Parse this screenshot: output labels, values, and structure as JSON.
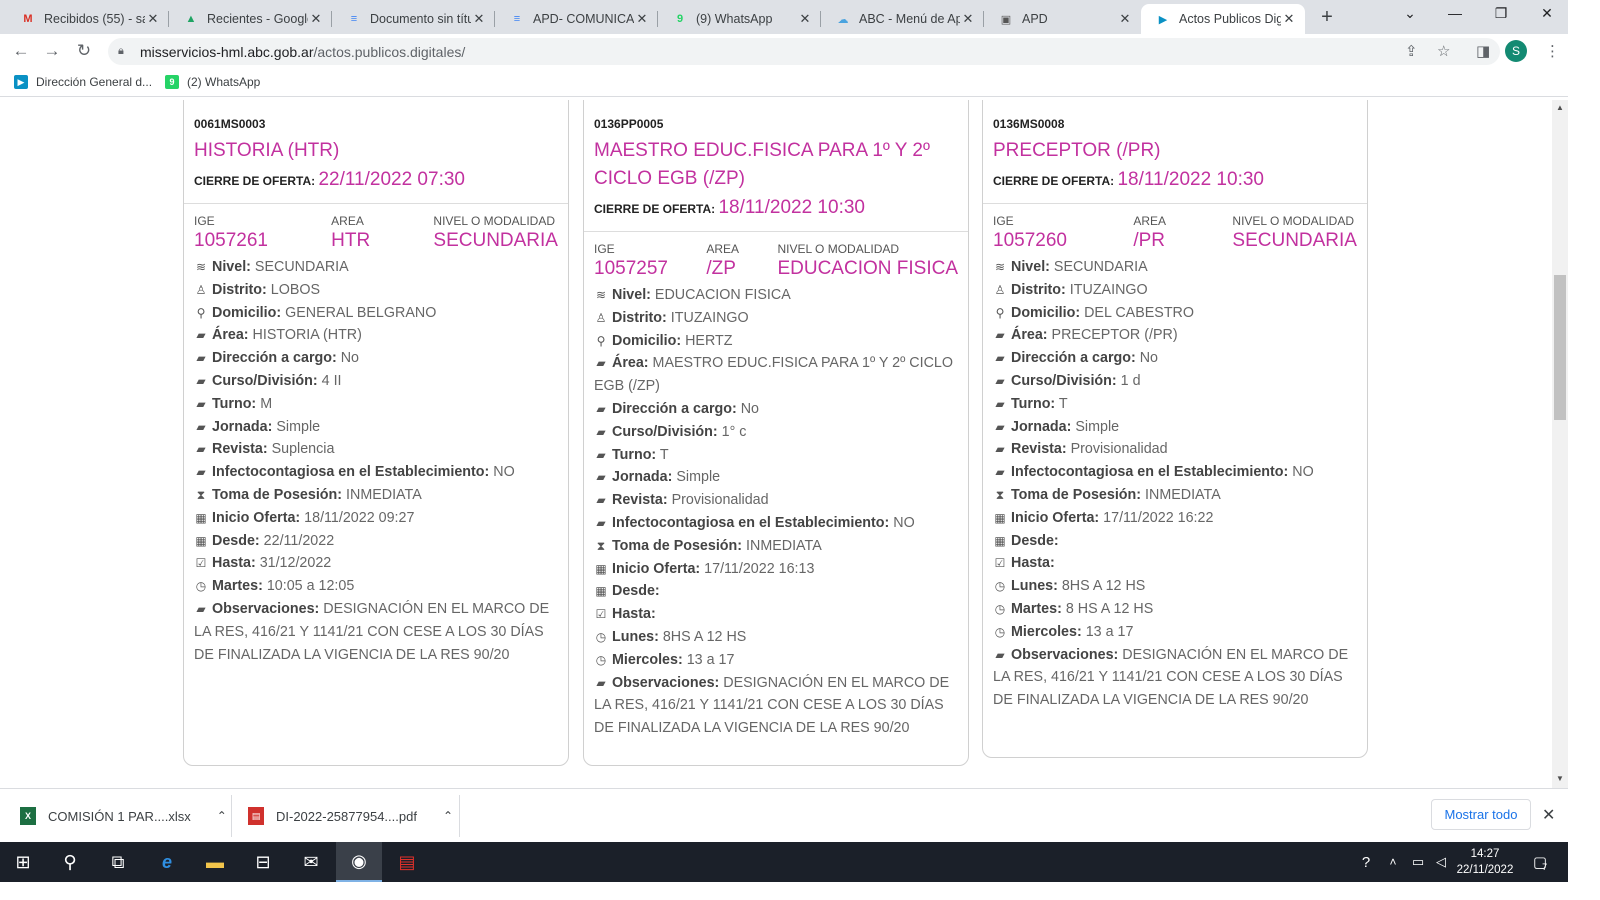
{
  "browser": {
    "tabs": [
      {
        "title": "Recibidos (55) - sar",
        "icon": "gmail-icon",
        "glyph": "M",
        "color": "#d93025"
      },
      {
        "title": "Recientes - Google",
        "icon": "google-drive-icon",
        "glyph": "▲",
        "color": "#1fa463"
      },
      {
        "title": "Documento sin títu",
        "icon": "google-docs-icon",
        "glyph": "≡",
        "color": "#4285f4"
      },
      {
        "title": "APD- COMUNICAD",
        "icon": "google-docs-icon",
        "glyph": "≡",
        "color": "#4285f4"
      },
      {
        "title": "(9) WhatsApp",
        "icon": "whatsapp-icon",
        "glyph": "9",
        "color": "#25d366"
      },
      {
        "title": "ABC - Menú de Ap",
        "icon": "cloud-icon",
        "glyph": "☁",
        "color": "#4aa3df"
      },
      {
        "title": "APD",
        "icon": "apd-icon",
        "glyph": "▣",
        "color": "#555"
      },
      {
        "title": "Actos Publicos Dig",
        "icon": "abc-flag-icon",
        "glyph": "▶",
        "color": "#0a91c4"
      }
    ],
    "new_tab": "+",
    "url_host": "misservicios-hml.abc.gob.ar",
    "url_path": "/actos.publicos.digitales/",
    "avatar_letter": "S",
    "bookmarks": [
      {
        "label": "Dirección General d...",
        "icon": "abc-flag-icon",
        "color": "#0a91c4",
        "glyph": "▶"
      },
      {
        "label": "(2) WhatsApp",
        "icon": "whatsapp-icon",
        "color": "#25d366",
        "glyph": "9"
      }
    ]
  },
  "cards": [
    {
      "code": "0061MS0003",
      "title": "HISTORIA (HTR)",
      "cierre_label": "CIERRE DE OFERTA:",
      "cierre_date": "22/11/2022 07:30",
      "ige_label": "IGE",
      "ige": "1057261",
      "area_label": "AREA",
      "area": "HTR",
      "nivel_label": "NIVEL O MODALIDAD",
      "nivel": "SECUNDARIA",
      "fields": [
        {
          "icon": "layers-icon",
          "glyph": "≋",
          "key": "Nivel:",
          "value": "SECUNDARIA"
        },
        {
          "icon": "street-view-icon",
          "glyph": "♙",
          "key": "Distrito:",
          "value": "LOBOS"
        },
        {
          "icon": "map-marker-icon",
          "glyph": "⚲",
          "key": "Domicilio:",
          "value": "GENERAL BELGRANO"
        },
        {
          "icon": "briefcase-icon",
          "glyph": "▰",
          "key": "Área:",
          "value": "HISTORIA (HTR)"
        },
        {
          "icon": "briefcase-icon",
          "glyph": "▰",
          "key": "Dirección a cargo:",
          "value": "No"
        },
        {
          "icon": "briefcase-icon",
          "glyph": "▰",
          "key": "Curso/División:",
          "value": "4 II"
        },
        {
          "icon": "briefcase-icon",
          "glyph": "▰",
          "key": "Turno:",
          "value": "M"
        },
        {
          "icon": "briefcase-icon",
          "glyph": "▰",
          "key": "Jornada:",
          "value": "Simple"
        },
        {
          "icon": "briefcase-icon",
          "glyph": "▰",
          "key": "Revista:",
          "value": "Suplencia"
        },
        {
          "icon": "briefcase-icon",
          "glyph": "▰",
          "key": "Infectocontagiosa en el Establecimiento:",
          "value": "NO"
        },
        {
          "icon": "hourglass-icon",
          "glyph": "⧗",
          "key": "Toma de Posesión:",
          "value": "INMEDIATA"
        },
        {
          "icon": "calendar-icon",
          "glyph": "▦",
          "key": "Inicio Oferta:",
          "value": "18/11/2022 09:27"
        },
        {
          "icon": "calendar-icon",
          "glyph": "▦",
          "key": "Desde:",
          "value": "22/11/2022"
        },
        {
          "icon": "calendar-check-icon",
          "glyph": "☑",
          "key": "Hasta:",
          "value": "31/12/2022"
        },
        {
          "icon": "clock-icon",
          "glyph": "◷",
          "key": "Martes:",
          "value": "10:05 a 12:05"
        },
        {
          "icon": "briefcase-icon",
          "glyph": "▰",
          "key": "Observaciones:",
          "value": "DESIGNACIÓN EN EL MARCO DE LA RES, 416/21 Y 1141/21 CON CESE A LOS 30 DÍAS DE FINALIZADA LA VIGENCIA DE LA RES 90/20"
        }
      ]
    },
    {
      "code": "0136PP0005",
      "title": "MAESTRO EDUC.FISICA PARA 1º Y 2º CICLO EGB (/ZP)",
      "cierre_label": "CIERRE DE OFERTA:",
      "cierre_date": "18/11/2022 10:30",
      "ige_label": "IGE",
      "ige": "1057257",
      "area_label": "AREA",
      "area": "/ZP",
      "nivel_label": "NIVEL O MODALIDAD",
      "nivel": "EDUCACION FISICA",
      "fields": [
        {
          "icon": "layers-icon",
          "glyph": "≋",
          "key": "Nivel:",
          "value": "EDUCACION FISICA"
        },
        {
          "icon": "street-view-icon",
          "glyph": "♙",
          "key": "Distrito:",
          "value": "ITUZAINGO"
        },
        {
          "icon": "map-marker-icon",
          "glyph": "⚲",
          "key": "Domicilio:",
          "value": "HERTZ"
        },
        {
          "icon": "briefcase-icon",
          "glyph": "▰",
          "key": "Área:",
          "value": "MAESTRO EDUC.FISICA PARA 1º Y 2º CICLO EGB (/ZP)"
        },
        {
          "icon": "briefcase-icon",
          "glyph": "▰",
          "key": "Dirección a cargo:",
          "value": "No"
        },
        {
          "icon": "briefcase-icon",
          "glyph": "▰",
          "key": "Curso/División:",
          "value": "1° c"
        },
        {
          "icon": "briefcase-icon",
          "glyph": "▰",
          "key": "Turno:",
          "value": "T"
        },
        {
          "icon": "briefcase-icon",
          "glyph": "▰",
          "key": "Jornada:",
          "value": "Simple"
        },
        {
          "icon": "briefcase-icon",
          "glyph": "▰",
          "key": "Revista:",
          "value": "Provisionalidad"
        },
        {
          "icon": "briefcase-icon",
          "glyph": "▰",
          "key": "Infectocontagiosa en el Establecimiento:",
          "value": "NO"
        },
        {
          "icon": "hourglass-icon",
          "glyph": "⧗",
          "key": "Toma de Posesión:",
          "value": "INMEDIATA"
        },
        {
          "icon": "calendar-icon",
          "glyph": "▦",
          "key": "Inicio Oferta:",
          "value": "17/11/2022 16:13"
        },
        {
          "icon": "calendar-icon",
          "glyph": "▦",
          "key": "Desde:",
          "value": ""
        },
        {
          "icon": "calendar-check-icon",
          "glyph": "☑",
          "key": "Hasta:",
          "value": ""
        },
        {
          "icon": "clock-icon",
          "glyph": "◷",
          "key": "Lunes:",
          "value": "8HS A 12 HS"
        },
        {
          "icon": "clock-icon",
          "glyph": "◷",
          "key": "Miercoles:",
          "value": "13 a 17"
        },
        {
          "icon": "briefcase-icon",
          "glyph": "▰",
          "key": "Observaciones:",
          "value": "DESIGNACIÓN EN EL MARCO DE LA RES, 416/21 Y 1141/21 CON CESE A LOS 30 DÍAS DE FINALIZADA LA VIGENCIA DE LA RES 90/20"
        }
      ]
    },
    {
      "code": "0136MS0008",
      "title": "PRECEPTOR (/PR)",
      "cierre_label": "CIERRE DE OFERTA:",
      "cierre_date": "18/11/2022 10:30",
      "ige_label": "IGE",
      "ige": "1057260",
      "area_label": "AREA",
      "area": "/PR",
      "nivel_label": "NIVEL O MODALIDAD",
      "nivel": "SECUNDARIA",
      "fields": [
        {
          "icon": "layers-icon",
          "glyph": "≋",
          "key": "Nivel:",
          "value": "SECUNDARIA"
        },
        {
          "icon": "street-view-icon",
          "glyph": "♙",
          "key": "Distrito:",
          "value": "ITUZAINGO"
        },
        {
          "icon": "map-marker-icon",
          "glyph": "⚲",
          "key": "Domicilio:",
          "value": "DEL CABESTRO"
        },
        {
          "icon": "briefcase-icon",
          "glyph": "▰",
          "key": "Área:",
          "value": "PRECEPTOR (/PR)"
        },
        {
          "icon": "briefcase-icon",
          "glyph": "▰",
          "key": "Dirección a cargo:",
          "value": "No"
        },
        {
          "icon": "briefcase-icon",
          "glyph": "▰",
          "key": "Curso/División:",
          "value": "1 d"
        },
        {
          "icon": "briefcase-icon",
          "glyph": "▰",
          "key": "Turno:",
          "value": "T"
        },
        {
          "icon": "briefcase-icon",
          "glyph": "▰",
          "key": "Jornada:",
          "value": "Simple"
        },
        {
          "icon": "briefcase-icon",
          "glyph": "▰",
          "key": "Revista:",
          "value": "Provisionalidad"
        },
        {
          "icon": "briefcase-icon",
          "glyph": "▰",
          "key": "Infectocontagiosa en el Establecimiento:",
          "value": "NO"
        },
        {
          "icon": "hourglass-icon",
          "glyph": "⧗",
          "key": "Toma de Posesión:",
          "value": "INMEDIATA"
        },
        {
          "icon": "calendar-icon",
          "glyph": "▦",
          "key": "Inicio Oferta:",
          "value": "17/11/2022 16:22"
        },
        {
          "icon": "calendar-icon",
          "glyph": "▦",
          "key": "Desde:",
          "value": ""
        },
        {
          "icon": "calendar-check-icon",
          "glyph": "☑",
          "key": "Hasta:",
          "value": ""
        },
        {
          "icon": "clock-icon",
          "glyph": "◷",
          "key": "Lunes:",
          "value": "8HS A 12 HS"
        },
        {
          "icon": "clock-icon",
          "glyph": "◷",
          "key": "Martes:",
          "value": "8 HS A 12 HS"
        },
        {
          "icon": "clock-icon",
          "glyph": "◷",
          "key": "Miercoles:",
          "value": "13 a 17"
        },
        {
          "icon": "briefcase-icon",
          "glyph": "▰",
          "key": "Observaciones:",
          "value": "DESIGNACIÓN EN EL MARCO DE LA RES, 416/21 Y 1141/21 CON CESE A LOS 30 DÍAS DE FINALIZADA LA VIGENCIA DE LA RES 90/20"
        }
      ]
    }
  ],
  "downloads": {
    "items": [
      {
        "name": "COMISIÓN 1 PAR....xlsx",
        "icon": "excel-file-icon",
        "color": "#1d6f42",
        "glyph": "X"
      },
      {
        "name": "DI-2022-25877954....pdf",
        "icon": "pdf-file-icon",
        "color": "#d0312d",
        "glyph": "▤"
      }
    ],
    "show_all": "Mostrar todo"
  },
  "taskbar": {
    "time": "14:27",
    "date": "22/11/2022",
    "notification_count": "7"
  },
  "colors": {
    "accent": "#c2319f",
    "chrome_tabbar": "#dee1e6",
    "taskbar": "#1b2029"
  }
}
